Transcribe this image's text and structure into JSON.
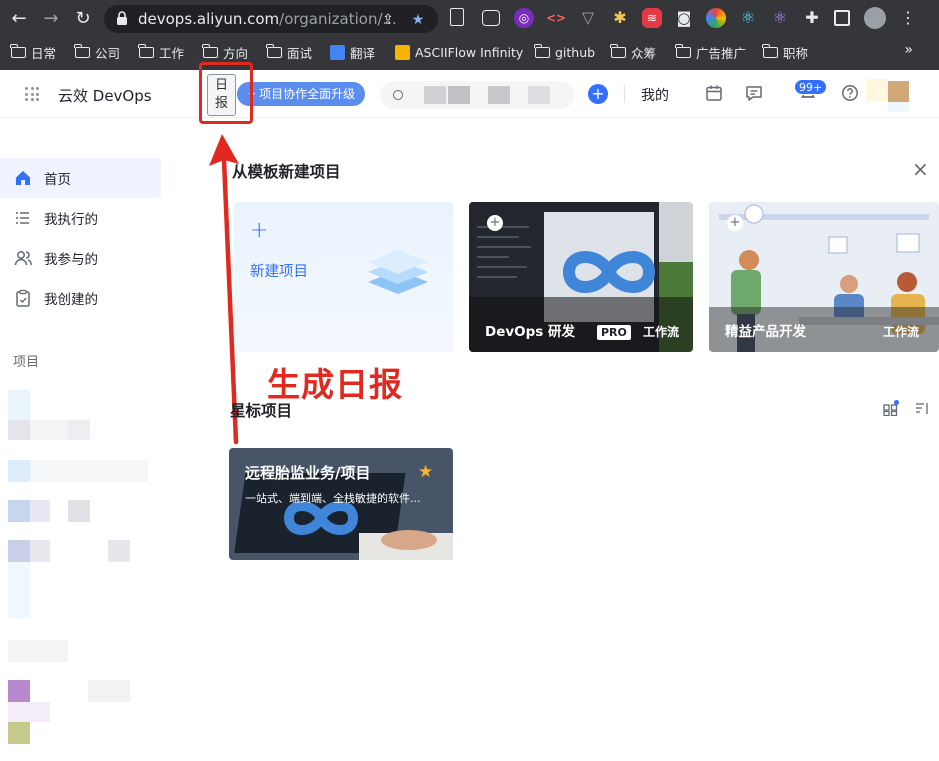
{
  "browser": {
    "url_host": "devops.aliyun.com",
    "url_path": "/organization/...",
    "bookmarks": [
      {
        "label": "日常"
      },
      {
        "label": "公司"
      },
      {
        "label": "工作"
      },
      {
        "label": "方向"
      },
      {
        "label": "面试"
      },
      {
        "label": "翻译"
      },
      {
        "label": "ASCIIFlow Infinity"
      },
      {
        "label": "github"
      },
      {
        "label": "众筹"
      },
      {
        "label": "广告推广"
      },
      {
        "label": "职称"
      }
    ],
    "more": "»"
  },
  "header": {
    "brand": "云效 DevOps",
    "daily_btn_line1": "日",
    "daily_btn_line2": "报",
    "upgrade": "项目协作全面升级",
    "mine": "我的",
    "badge": "99+"
  },
  "sidebar": {
    "items": [
      {
        "label": "首页",
        "icon": "home-icon"
      },
      {
        "label": "我执行的",
        "icon": "list-icon"
      },
      {
        "label": "我参与的",
        "icon": "users-icon"
      },
      {
        "label": "我创建的",
        "icon": "clipboard-icon"
      }
    ],
    "section": "项目"
  },
  "main": {
    "template_title": "从模板新建项目",
    "new_project": "新建项目",
    "cards": [
      {
        "title": "DevOps 研发",
        "pro": "PRO",
        "tag": "工作流"
      },
      {
        "title": "精益产品开发",
        "tag": "工作流"
      }
    ],
    "annotation": "生成日报",
    "starred_title": "星标项目",
    "starred": {
      "title": "远程胎监业务/项目",
      "subtitle": "一站式、端到端、全栈敏捷的软件..."
    }
  },
  "colors": {
    "accent": "#3370ff",
    "annotation": "#e0291f",
    "chrome": "#35363a"
  }
}
